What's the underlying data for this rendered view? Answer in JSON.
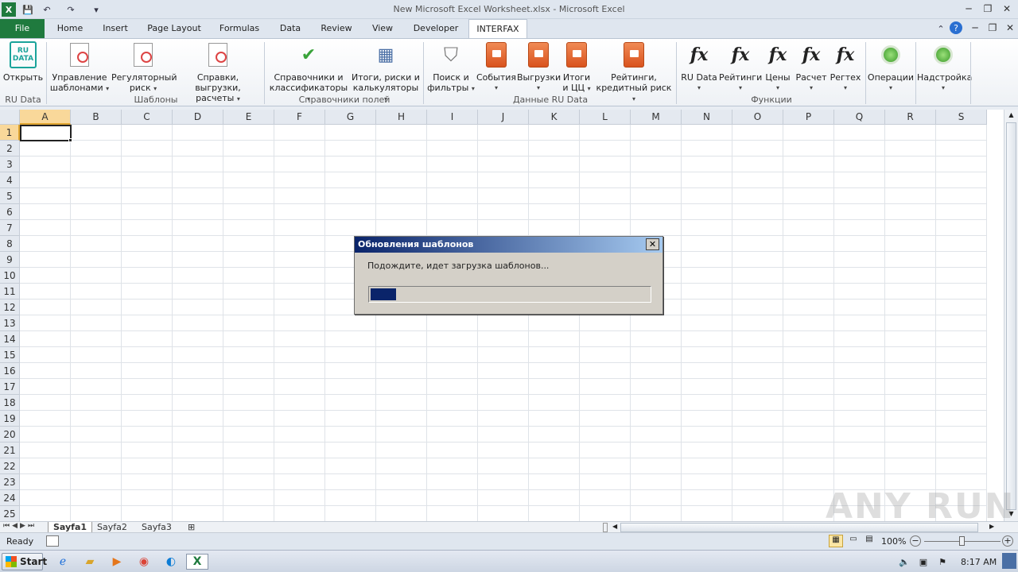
{
  "window": {
    "title": "New Microsoft Excel Worksheet.xlsx - Microsoft Excel"
  },
  "tabs": [
    "File",
    "Home",
    "Insert",
    "Page Layout",
    "Formulas",
    "Data",
    "Review",
    "View",
    "Developer",
    "INTERFAX"
  ],
  "ribbon": {
    "rudata": {
      "logo": "RU DATA",
      "open": "Открыть",
      "group": "RU Data"
    },
    "templates": {
      "manage": [
        "Управление",
        "шаблонами"
      ],
      "regulatory": [
        "Регуляторный",
        "риск"
      ],
      "reports": [
        "Справки, выгрузки,",
        "расчеты"
      ],
      "group": "Шаблоны"
    },
    "fields": {
      "dirs": [
        "Справочники и",
        "классификаторы"
      ],
      "totals": [
        "Итоги, риски и",
        "калькуляторы"
      ],
      "group": "Справочники полей"
    },
    "data": {
      "search": [
        "Поиск и",
        "фильтры"
      ],
      "events": "События",
      "exports": "Выгрузки",
      "totalsCC": [
        "Итоги",
        "и ЦЦ"
      ],
      "ratings": [
        "Рейтинги,",
        "кредитный риск"
      ],
      "group": "Данные RU Data"
    },
    "functions": {
      "items": [
        "RU Data",
        "Рейтинги",
        "Цены",
        "Расчет",
        "Регтех"
      ],
      "symbol": "fx",
      "group": "Функции"
    },
    "ops": "Операции",
    "settings": "Надстройка"
  },
  "grid": {
    "columns": [
      "A",
      "B",
      "C",
      "D",
      "E",
      "F",
      "G",
      "H",
      "I",
      "J",
      "K",
      "L",
      "M",
      "N",
      "O",
      "P",
      "Q",
      "R",
      "S"
    ],
    "rows": [
      "1",
      "2",
      "3",
      "4",
      "5",
      "6",
      "7",
      "8",
      "9",
      "10",
      "11",
      "12",
      "13",
      "14",
      "15",
      "16",
      "17",
      "18",
      "19",
      "20",
      "21",
      "22",
      "23",
      "24",
      "25"
    ],
    "active_cell": "A1"
  },
  "sheets": [
    "Sayfa1",
    "Sayfa2",
    "Sayfa3"
  ],
  "active_sheet": "Sayfa1",
  "status": {
    "ready": "Ready",
    "zoom": "100%"
  },
  "dialog": {
    "title": "Обновления шаблонов",
    "message": "Подождите, идет загрузка шаблонов...",
    "close": "✕",
    "progress": 0.09
  },
  "taskbar": {
    "start": "Start",
    "time": "8:17 AM"
  },
  "watermark": "ANY RUN",
  "colors": {
    "file_tab": "#1f7a3e",
    "dialog_title": "#0a246a",
    "progress": "#0a246a"
  }
}
